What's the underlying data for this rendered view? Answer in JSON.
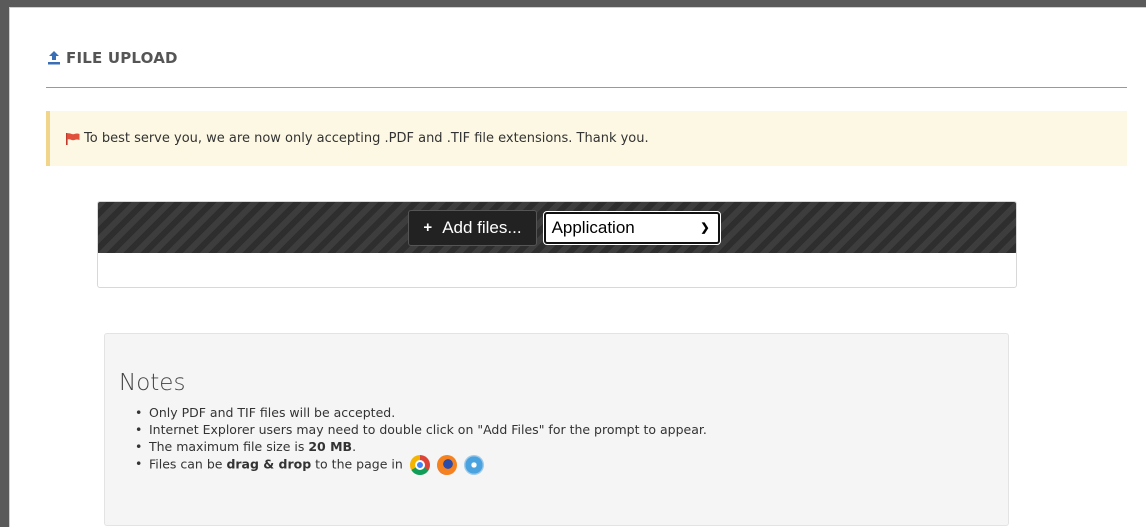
{
  "header": {
    "title": "FILE UPLOAD",
    "icon": "upload-icon"
  },
  "alert": {
    "icon": "flag-icon",
    "message": "To best serve you, we are now only accepting .PDF and .TIF file extensions. Thank you.",
    "flag_color": "#e0503a"
  },
  "uploader": {
    "add_files_label": "Add files...",
    "document_type_selected": "Application"
  },
  "notes": {
    "title": "Notes",
    "items": [
      "Only PDF and TIF files will be accepted.",
      "Internet Explorer users may need to double click on \"Add Files\" for the prompt to appear.",
      "The maximum file size is ",
      "20 MB",
      ".",
      "Files can be ",
      "drag & drop",
      " to the page in"
    ],
    "browser_icons": [
      "chrome-icon",
      "firefox-icon",
      "safari-icon"
    ]
  },
  "colors": {
    "toolbar": "#2e2e2e",
    "alert_bg": "#fcf8e3",
    "alert_border": "#f0d58a",
    "notes_bg": "#f5f5f5",
    "icon_blue": "#3a6fb5"
  }
}
